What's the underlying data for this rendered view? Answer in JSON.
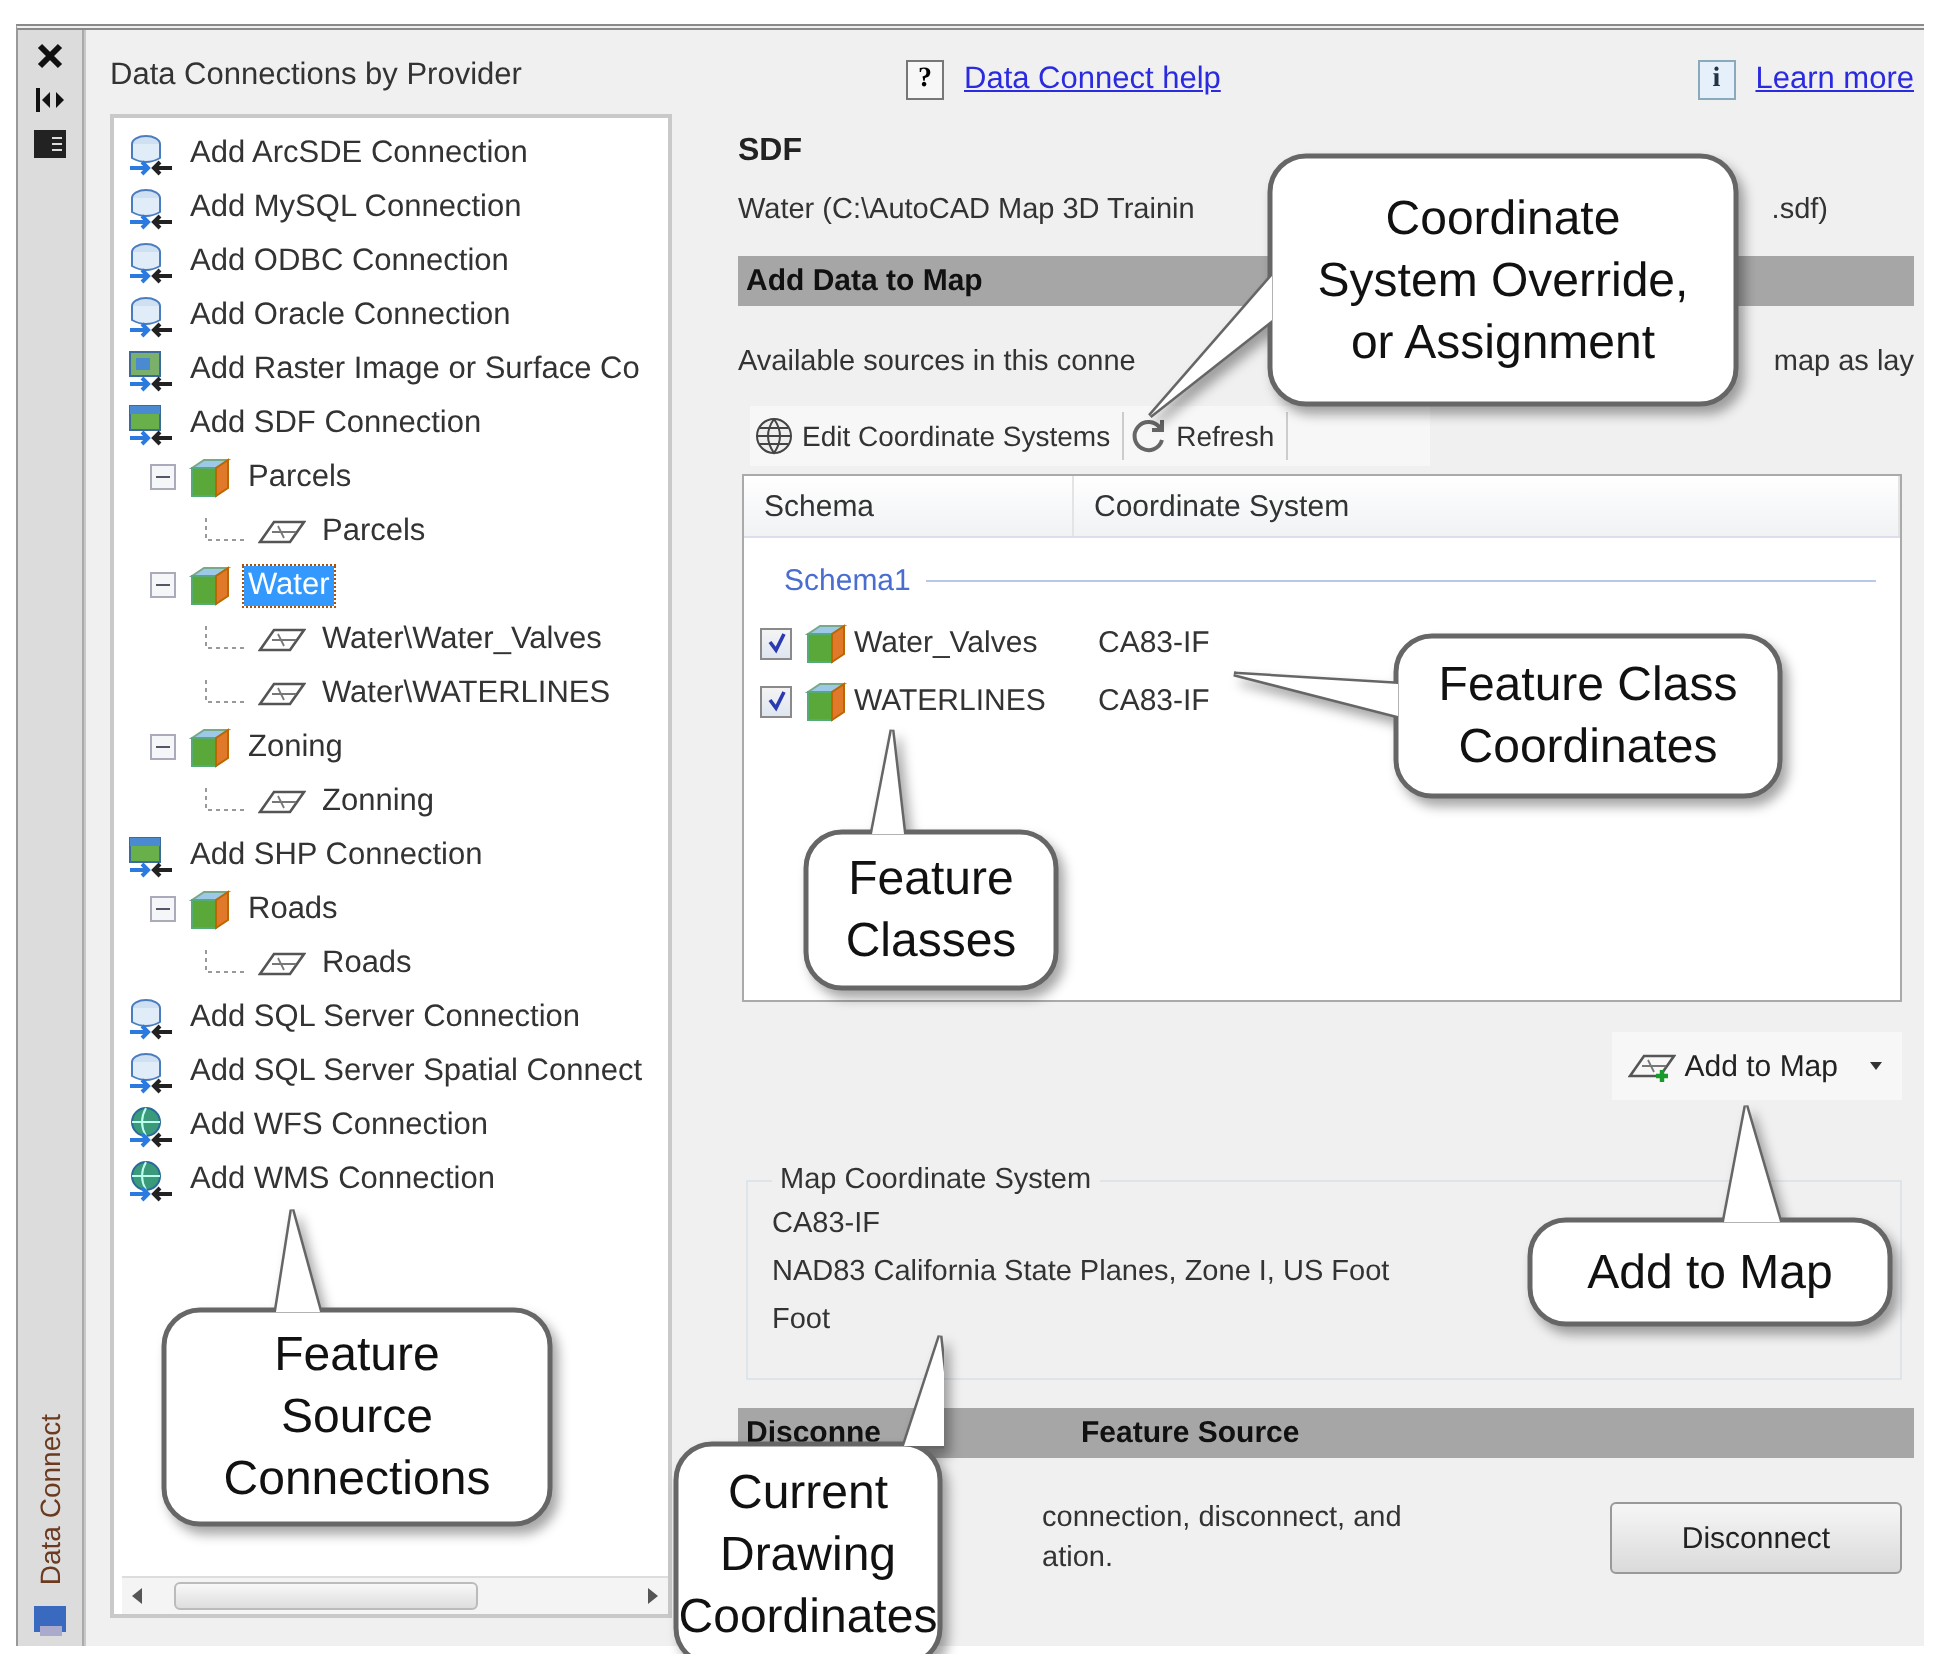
{
  "dock_strip": {
    "label": "Data Connect"
  },
  "provider_panel": {
    "title": "Data Connections by Provider",
    "tree": [
      {
        "label": "Add ArcSDE Connection",
        "kind": "database",
        "selected": false
      },
      {
        "label": "Add MySQL Connection",
        "kind": "database",
        "selected": false
      },
      {
        "label": "Add ODBC Connection",
        "kind": "database",
        "selected": false
      },
      {
        "label": "Add Oracle Connection",
        "kind": "database",
        "selected": false
      },
      {
        "label": "Add Raster Image or Surface Co",
        "kind": "raster",
        "selected": false
      },
      {
        "label": "Add SDF Connection",
        "kind": "file",
        "selected": false,
        "children": [
          {
            "label": "Parcels",
            "kind": "schema",
            "selected": false,
            "expanded": true,
            "children": [
              {
                "label": "Parcels",
                "kind": "featureclass",
                "selected": false
              }
            ]
          },
          {
            "label": "Water",
            "kind": "schema",
            "selected": true,
            "expanded": true,
            "children": [
              {
                "label": "Water\\Water_Valves",
                "kind": "featureclass",
                "selected": false
              },
              {
                "label": "Water\\WATERLINES",
                "kind": "featureclass",
                "selected": false
              }
            ]
          },
          {
            "label": "Zoning",
            "kind": "schema",
            "selected": false,
            "expanded": true,
            "children": [
              {
                "label": "Zonning",
                "kind": "featureclass",
                "selected": false
              }
            ]
          }
        ]
      },
      {
        "label": "Add SHP Connection",
        "kind": "file",
        "selected": false,
        "children": [
          {
            "label": "Roads",
            "kind": "schema",
            "selected": false,
            "expanded": true,
            "children": [
              {
                "label": "Roads",
                "kind": "featureclass",
                "selected": false
              }
            ]
          }
        ]
      },
      {
        "label": "Add SQL Server Connection",
        "kind": "database",
        "selected": false
      },
      {
        "label": "Add SQL Server Spatial Connect",
        "kind": "database",
        "selected": false
      },
      {
        "label": "Add WFS Connection",
        "kind": "web",
        "selected": false
      },
      {
        "label": "Add WMS Connection",
        "kind": "web",
        "selected": false
      }
    ]
  },
  "help_links": [
    {
      "icon": "?",
      "label": "Data Connect help"
    },
    {
      "icon": "i",
      "label": "Learn more"
    }
  ],
  "connection": {
    "type": "SDF",
    "path_start": "Water (C:\\AutoCAD Map 3D Trainin",
    "path_end": ".sdf)"
  },
  "add_data_section": {
    "heading": "Add Data to Map",
    "description_start": "Available sources in this conne",
    "description_end": "map as lay",
    "toolbar": [
      {
        "label": "Edit Coordinate Systems",
        "kind": "globe"
      },
      {
        "label": "Refresh",
        "kind": "refresh"
      }
    ],
    "columns": [
      "Schema",
      "Coordinate System"
    ],
    "groups": [
      {
        "name": "Schema1",
        "rows": [
          {
            "name": "Water_Valves",
            "coordinate_system": "CA83-IF",
            "checked": true
          },
          {
            "name": "WATERLINES",
            "coordinate_system": "CA83-IF",
            "checked": true
          }
        ]
      }
    ],
    "add_button": {
      "label": "Add to Map"
    }
  },
  "map_coordinate_system": {
    "legend": "Map Coordinate System",
    "code": "CA83-IF",
    "description": "NAD83 California State Planes, Zone I, US Foot",
    "unit": "Foot"
  },
  "disconnect_section": {
    "heading_start": "Disconne",
    "heading_end": "Feature Source",
    "line_1": "connection, disconnect, and",
    "line_2": "ation.",
    "button": "Disconnect"
  },
  "callouts": [
    {
      "lines": [
        "Coordinate",
        "System Override,",
        "or Assignment"
      ]
    },
    {
      "lines": [
        "Feature Class",
        "Coordinates"
      ]
    },
    {
      "lines": [
        "Feature",
        "Classes"
      ]
    },
    {
      "lines": [
        "Feature",
        "Source",
        "Connections"
      ]
    },
    {
      "lines": [
        "Add to Map"
      ]
    },
    {
      "lines": [
        "Current",
        "Drawing",
        "Coordinates"
      ]
    }
  ]
}
